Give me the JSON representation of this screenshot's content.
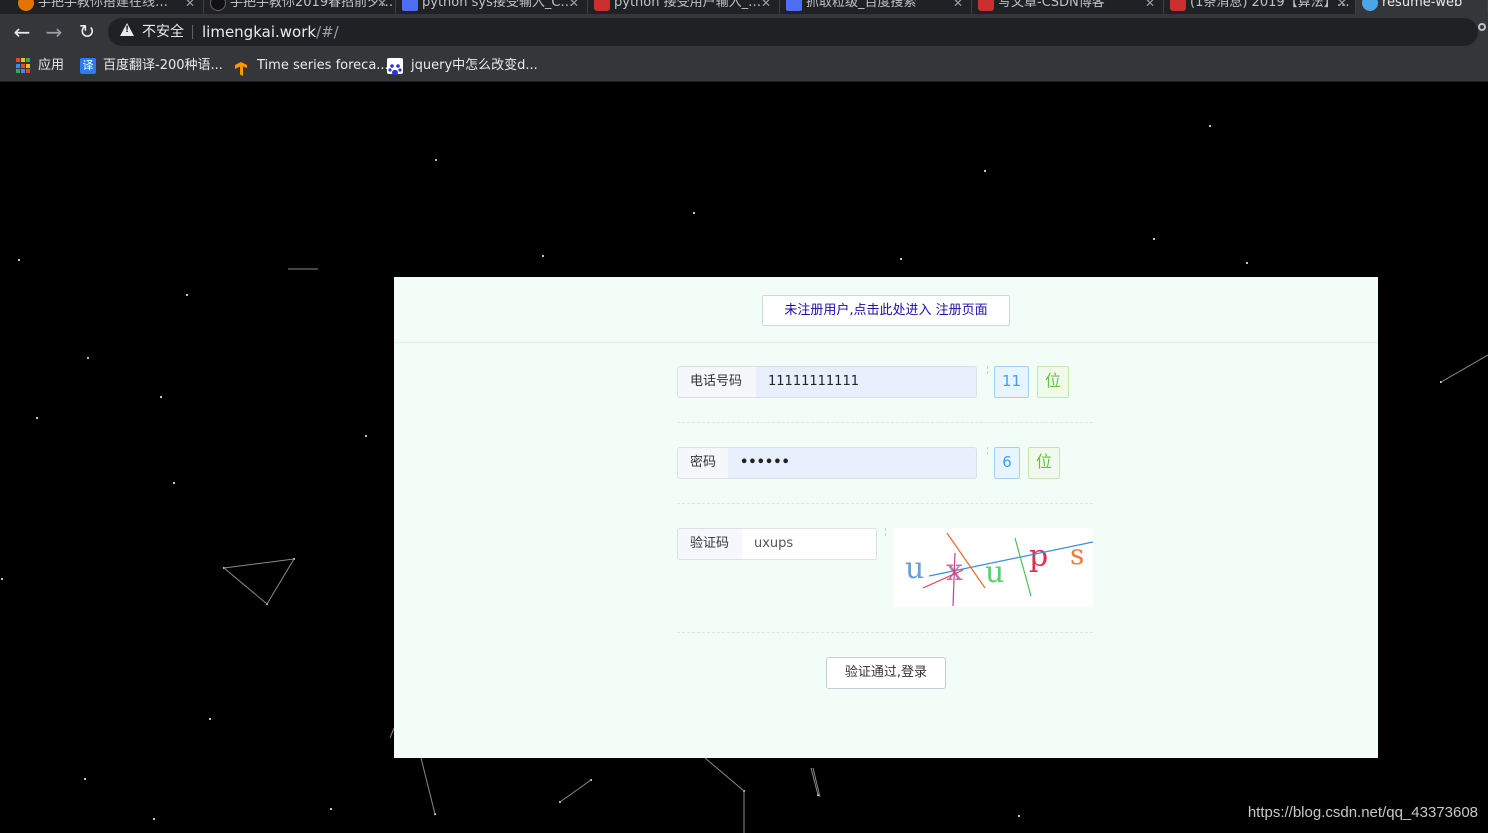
{
  "browser": {
    "tabs": [
      {
        "label": "手把手教你搭建在线…",
        "color": "#e37400"
      },
      {
        "label": "手把手教你2019春招前夕…",
        "color": "#111111"
      },
      {
        "label": "python sys接受输入_C…",
        "color": "#4e6ef2"
      },
      {
        "label": "python 接受用户输入_…",
        "color": "#c9302c"
      },
      {
        "label": "抓取粒级_百度搜索",
        "color": "#4e6ef2"
      },
      {
        "label": "写文章-CSDN博客",
        "color": "#c9302c"
      },
      {
        "label": "(1条消息) 2019【算法】…",
        "color": "#c9302c"
      },
      {
        "label": "resume-web",
        "color": "#4ba6e8"
      }
    ],
    "address": {
      "security_label": "不安全",
      "host": "limengkai.work",
      "path": "/#/"
    },
    "bookmarks": [
      {
        "label": "应用",
        "icon": "apps-grid-icon"
      },
      {
        "label": "百度翻译-200种语...",
        "icon": "translate-icon"
      },
      {
        "label": "Time series foreca...",
        "icon": "tensorflow-icon"
      },
      {
        "label": "jquery中怎么改变d...",
        "icon": "baidu-paw-icon"
      }
    ]
  },
  "login": {
    "register_link": "未注册用户,点击此处进入 注册页面",
    "phone": {
      "label": "电话号码",
      "value": "11111111111",
      "count": "11",
      "unit": "位"
    },
    "password": {
      "label": "密码",
      "value": "••••••",
      "count": "6",
      "unit": "位"
    },
    "captcha": {
      "label": "验证码",
      "value": "uxups",
      "chars": [
        "u",
        "x",
        "u",
        "p",
        "s"
      ]
    },
    "submit": "验证通过,登录"
  },
  "watermark": "https://blog.csdn.net/qq_43373608"
}
